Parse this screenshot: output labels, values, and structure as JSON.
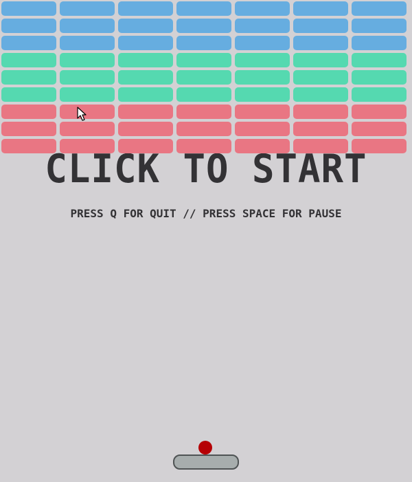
{
  "game": {
    "title": "CLICK TO START",
    "instructions": "PRESS Q FOR QUIT // PRESS SPACE FOR PAUSE"
  },
  "bricks": {
    "columns": 7,
    "rows": [
      {
        "color": "#66ade0"
      },
      {
        "color": "#66ade0"
      },
      {
        "color": "#66ade0"
      },
      {
        "color": "#55d9b0"
      },
      {
        "color": "#55d9b0"
      },
      {
        "color": "#55d9b0"
      },
      {
        "color": "#e97683"
      },
      {
        "color": "#e97683"
      },
      {
        "color": "#e97683"
      }
    ]
  },
  "colors": {
    "background": "#d3d1d4",
    "text": "#333235",
    "ball": "#b50005",
    "paddle": "#a7adad",
    "paddle_border": "#4f5354"
  }
}
